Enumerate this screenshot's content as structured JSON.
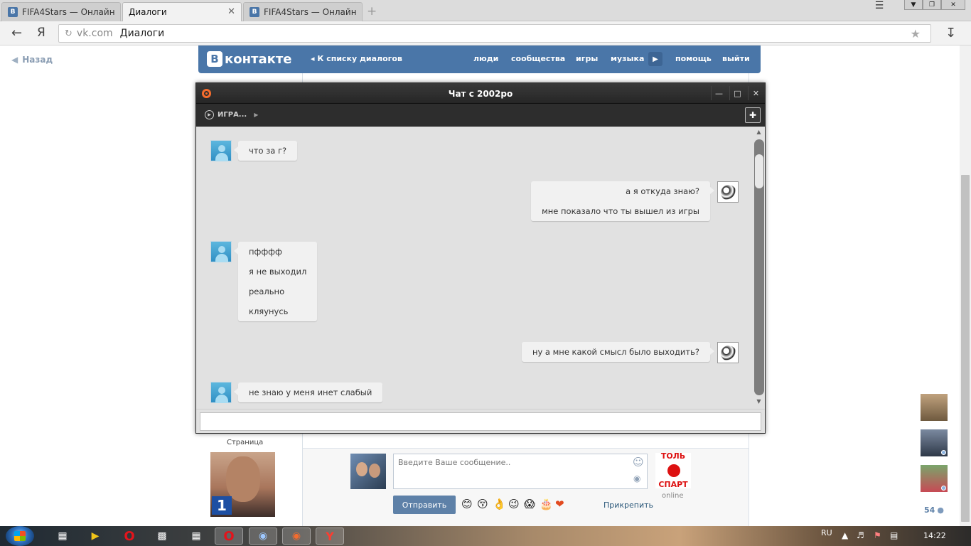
{
  "browser": {
    "tabs": [
      {
        "label": "FIFA4Stars — Онлайн",
        "favicon": "В"
      },
      {
        "label": "Диалоги",
        "favicon": "chat"
      },
      {
        "label": "FIFA4Stars — Онлайн",
        "favicon": "В"
      }
    ],
    "address_domain": "vk.com",
    "address_title": "Диалоги",
    "nav_ya": "Я"
  },
  "page": {
    "back_link": "Назад",
    "vk_logo_b": "В",
    "vk_logo_text": "контакте",
    "dialogs_link": "К списку диалогов",
    "nav": [
      "люди",
      "сообщества",
      "игры",
      "музыка",
      "помощь",
      "выйти"
    ],
    "left_label": "Страница",
    "composer_placeholder": "Введите Ваше сообщение..",
    "send_label": "Отправить",
    "attach_label": "Прикрепить",
    "emojis": [
      "😊",
      "😚",
      "👌",
      "😉",
      "😱",
      "🎂",
      "❤"
    ],
    "spartak_top": "ТОЛЬ",
    "spartak_bottom": "СПАРТ",
    "spartak_status": "online",
    "friends_count": "54",
    "accent_color": "#4a76a8"
  },
  "chat": {
    "title": "Чат с 2002ро",
    "game_label": "ИГРА...",
    "messages": [
      {
        "side": "left",
        "lines": [
          "что за г?"
        ]
      },
      {
        "side": "right",
        "lines": [
          "а я откуда знаю?",
          "мне показало что ты вышел из игры"
        ]
      },
      {
        "side": "left",
        "lines": [
          "пфффф",
          "я не выходил",
          "реально",
          "кляунусь"
        ]
      },
      {
        "side": "right",
        "lines": [
          "ну а мне какой смысл было выходить?"
        ]
      },
      {
        "side": "left",
        "lines": [
          "не знаю у меня инет слабый"
        ]
      }
    ]
  },
  "taskbar": {
    "language": "RU",
    "time": "14:22"
  }
}
